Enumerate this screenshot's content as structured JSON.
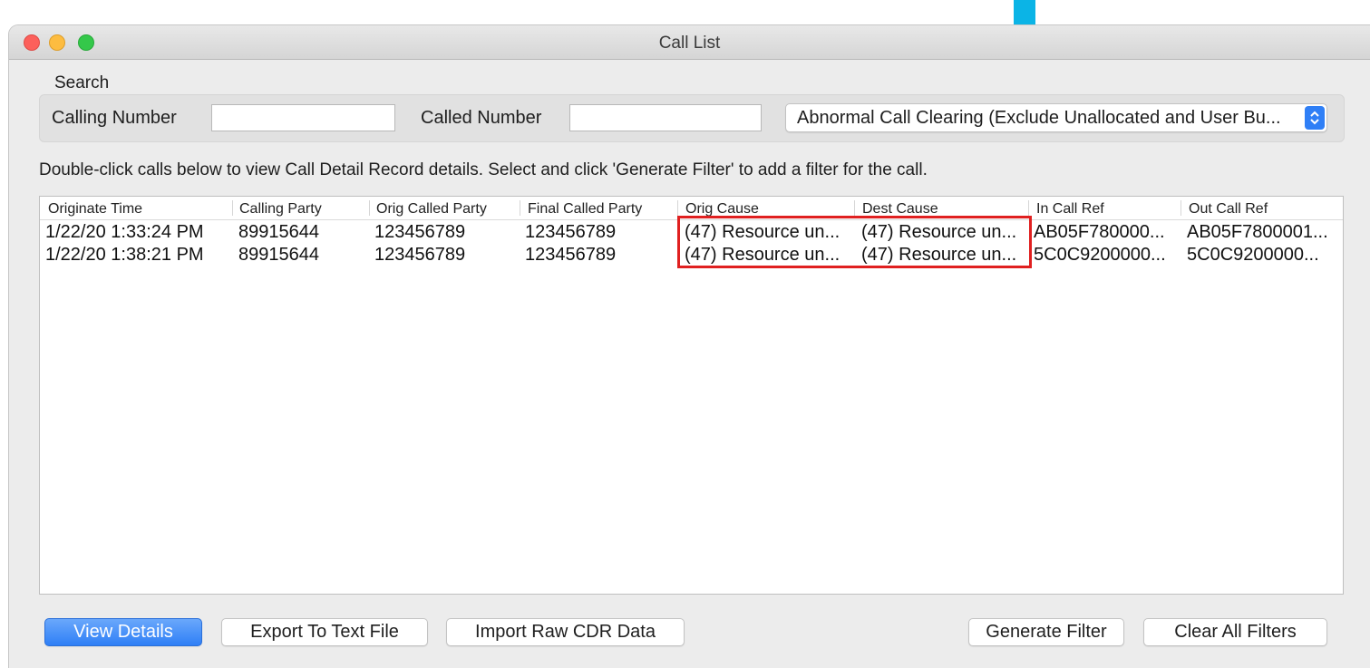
{
  "window": {
    "title": "Call List"
  },
  "search": {
    "label": "Search",
    "calling_label": "Calling Number",
    "calling_value": "",
    "called_label": "Called Number",
    "called_value": "",
    "filter_selected": "Abnormal Call Clearing (Exclude Unallocated and User Bu..."
  },
  "instructions": "Double-click calls below to view Call Detail Record details. Select and click 'Generate Filter' to add a filter for the call.",
  "table": {
    "columns": [
      "Originate Time",
      "Calling Party",
      "Orig Called Party",
      "Final Called Party",
      "Orig Cause",
      "Dest Cause",
      "In Call Ref",
      "Out Call Ref"
    ],
    "rows": [
      [
        "1/22/20 1:33:24 PM",
        "89915644",
        "123456789",
        "123456789",
        "(47) Resource un...",
        "(47) Resource un...",
        "AB05F780000...",
        "AB05F7800001..."
      ],
      [
        "1/22/20 1:38:21 PM",
        "89915644",
        "123456789",
        "123456789",
        "(47) Resource un...",
        "(47) Resource un...",
        "5C0C9200000...",
        "5C0C9200000..."
      ]
    ]
  },
  "buttons": {
    "view_details": "View Details",
    "export": "Export To Text File",
    "import": "Import Raw CDR Data",
    "generate_filter": "Generate Filter",
    "clear_filters": "Clear All Filters"
  },
  "colors": {
    "accent": "#2f7ff6",
    "highlight_box": "#e02020",
    "annotation_arrow": "#0bb4e6"
  }
}
